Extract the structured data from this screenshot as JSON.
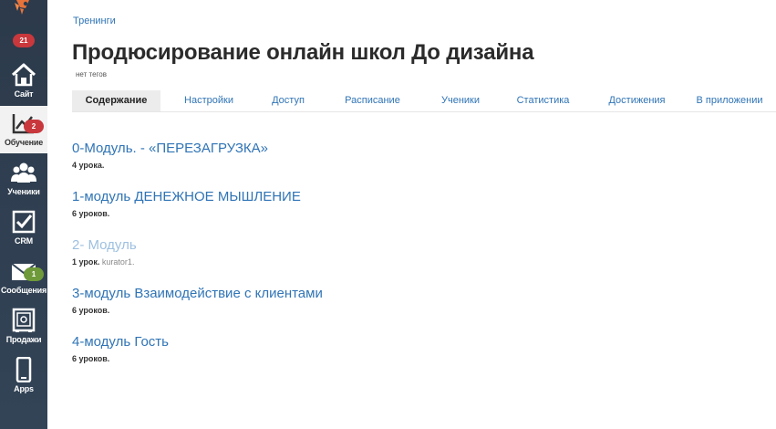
{
  "sidebar": {
    "top_badge": "21",
    "items": [
      {
        "label": "Сайт",
        "badge": ""
      },
      {
        "label": "Обучение",
        "badge": "2"
      },
      {
        "label": "Ученики",
        "badge": ""
      },
      {
        "label": "CRM",
        "badge": ""
      },
      {
        "label": "Сообщения",
        "badge": "1"
      },
      {
        "label": "Продажи",
        "badge": ""
      },
      {
        "label": "Apps",
        "badge": ""
      }
    ]
  },
  "colors": {
    "sidebar_bg": "#2c3a4b",
    "link": "#2f74b6",
    "link_dim": "#9ec0e0",
    "badge_red": "#c8383c",
    "badge_green": "#6f9a3a"
  },
  "breadcrumb": "Тренинги",
  "page_title": "Продюсирование онлайн школ До дизайна",
  "tags": "нет тегов",
  "tabs": [
    "Содержание",
    "Настройки",
    "Доступ",
    "Расписание",
    "Ученики",
    "Статистика",
    "Достижения",
    "В приложении"
  ],
  "modules": [
    {
      "title": "0-Модуль. - «ПЕРЕЗАГРУЗКА»",
      "lessons": "4 урока.",
      "curator": ""
    },
    {
      "title": "1-модуль ДЕНЕЖНОЕ МЫШЛЕНИЕ",
      "lessons": "6 уроков.",
      "curator": ""
    },
    {
      "title": "2- Модуль",
      "lessons": "1 урок.",
      "curator": "kurator1."
    },
    {
      "title": "3-модуль Взаимодействие с клиентами",
      "lessons": "6 уроков.",
      "curator": ""
    },
    {
      "title": "4-модуль Гость",
      "lessons": "6 уроков.",
      "curator": ""
    }
  ]
}
